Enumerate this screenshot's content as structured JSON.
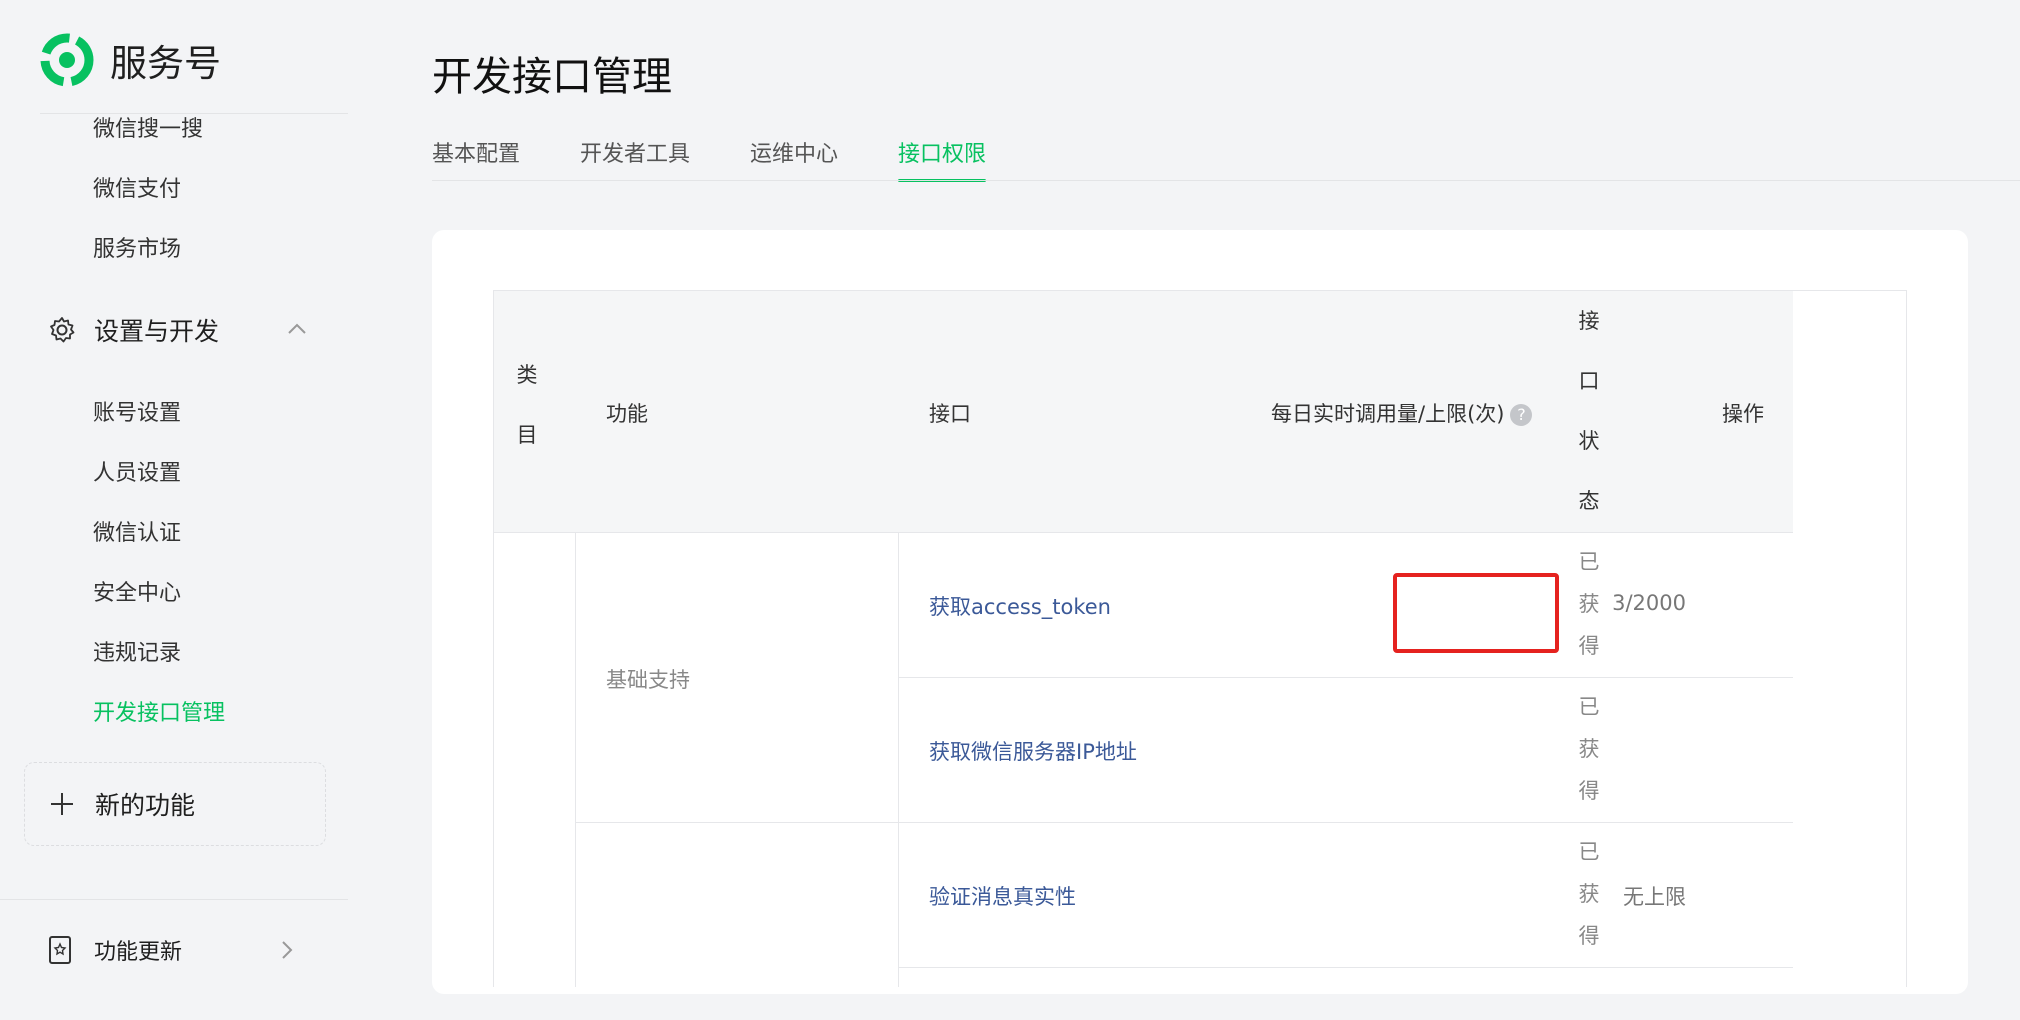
{
  "brand": {
    "name": "服务号",
    "accent": "#07c160"
  },
  "sidebar": {
    "top_items": [
      "微信搜一搜",
      "微信支付",
      "服务市场"
    ],
    "group": {
      "label": "设置与开发",
      "icon": "gear-icon",
      "expanded": true
    },
    "group_items": [
      "账号设置",
      "人员设置",
      "微信认证",
      "安全中心",
      "违规记录",
      "开发接口管理"
    ],
    "active_item": "开发接口管理",
    "new_feature": "新的功能",
    "update": "功能更新"
  },
  "page": {
    "title": "开发接口管理"
  },
  "tabs": [
    {
      "label": "基本配置",
      "active": false
    },
    {
      "label": "开发者工具",
      "active": false
    },
    {
      "label": "运维中心",
      "active": false
    },
    {
      "label": "接口权限",
      "active": true
    }
  ],
  "table": {
    "headers": {
      "category": "类目",
      "function": "功能",
      "api": "接口",
      "quota": "每日实时调用量/上限(次)",
      "status": "接口状态",
      "action": "操作"
    },
    "groups": [
      {
        "function": "基础支持"
      },
      {
        "function": ""
      }
    ],
    "rows": [
      {
        "api": "获取access_token",
        "quota": "3/2000",
        "status": "已获得",
        "highlighted": true
      },
      {
        "api": "获取微信服务器IP地址",
        "quota": "",
        "status": "已获得"
      },
      {
        "api": "验证消息真实性",
        "quota": "无上限",
        "status": "已获得"
      }
    ],
    "highlight_color": "#e5221f"
  }
}
